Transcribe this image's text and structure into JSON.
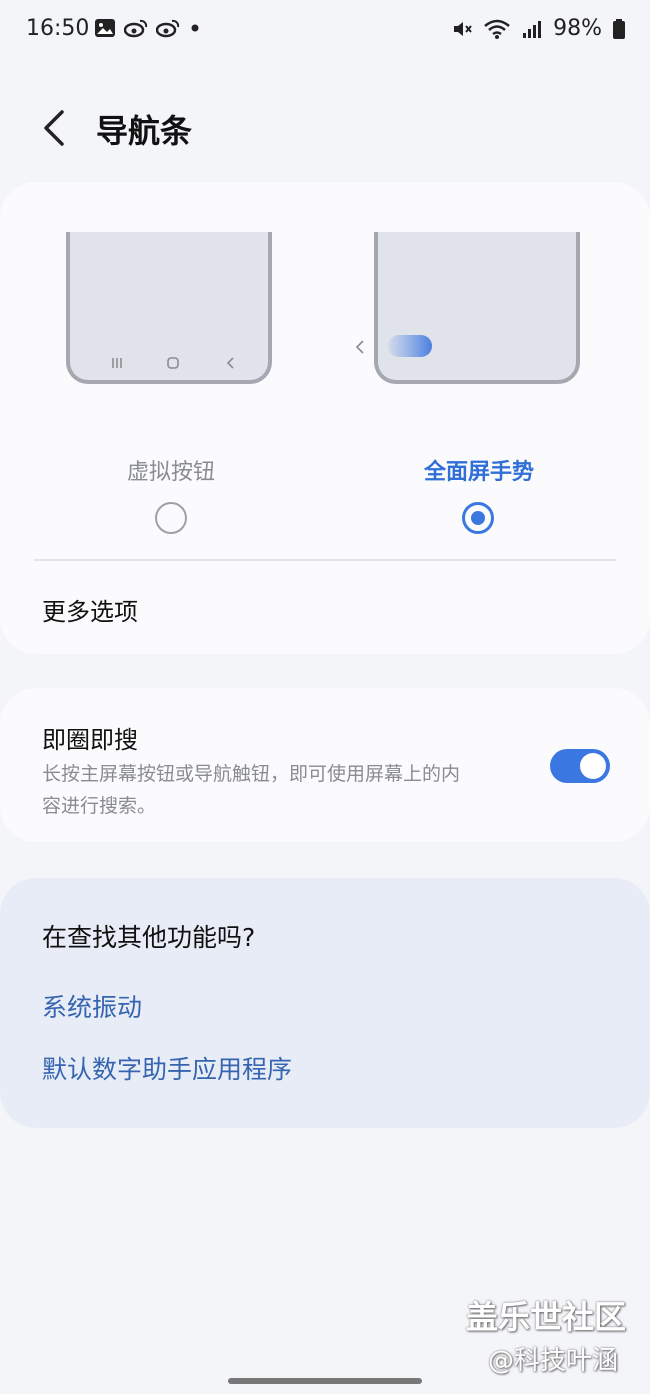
{
  "status_bar": {
    "time": "16:50",
    "left_icons": [
      "gallery-icon",
      "weibo-icon",
      "weibo-icon",
      "dot-icon"
    ],
    "battery": "98%",
    "right_icons": [
      "mute-icon",
      "wifi-icon",
      "signal-icon",
      "battery-icon"
    ]
  },
  "header": {
    "title": "导航条"
  },
  "navigation_options": {
    "buttons_label": "虚拟按钮",
    "gesture_label": "全面屏手势",
    "selected": "全面屏手势"
  },
  "more_options": {
    "label": "更多选项"
  },
  "circle_to_search": {
    "title": "即圈即搜",
    "description_line1": "长按主屏幕按钮或导航触钮，即可使用屏幕上的内",
    "description_line2": "容进行搜索。",
    "enabled": true
  },
  "looking_for": {
    "title": "在查找其他功能吗?",
    "links": [
      "系统振动",
      "默认数字助手应用程序"
    ]
  },
  "watermark": {
    "line1": "盖乐世社区",
    "line2": "@科技叶涵"
  },
  "colors": {
    "accent": "#3a77e0",
    "link": "#3565b0",
    "background": "#f4f5f9"
  }
}
